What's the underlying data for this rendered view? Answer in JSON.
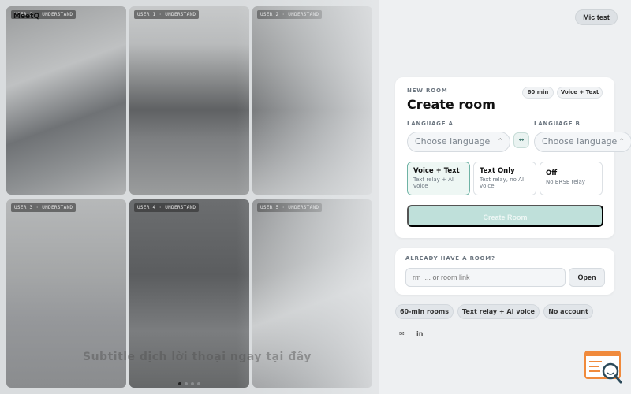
{
  "app": {
    "brand": "MeetQ"
  },
  "gallery": {
    "tiles": [
      {
        "tag": "USER_1 · UNDERSTAND"
      },
      {
        "tag": "USER_1 · UNDERSTAND"
      },
      {
        "tag": "USER_2 · UNDERSTAND"
      },
      {
        "tag": "USER_3 · UNDERSTAND"
      },
      {
        "tag": "USER_4 · UNDERSTAND"
      },
      {
        "tag": "USER_5 · UNDERSTAND"
      }
    ],
    "subtitle": "Subtitle dịch lời thoại ngay tại đây",
    "pager_active": 1
  },
  "header": {
    "mic_test": "Mic test"
  },
  "create_room": {
    "eyebrow": "NEW ROOM",
    "title": "Create room",
    "duration_pill": "60 min",
    "mode_pill": "Voice + Text",
    "language_a_label": "LANGUAGE A",
    "language_b_label": "LANGUAGE B",
    "language_a_value": "Choose language",
    "language_b_value": "Choose language",
    "swap_symbol": "↔",
    "modes": [
      {
        "title": "Voice + Text",
        "desc": "Text relay + AI voice",
        "selected": true
      },
      {
        "title": "Text Only",
        "desc": "Text relay, no AI voice",
        "selected": false
      },
      {
        "title": "Off",
        "desc": "No BRSE relay",
        "selected": false
      }
    ],
    "create_button": "Create Room"
  },
  "join_room": {
    "eyebrow": "ALREADY HAVE A ROOM?",
    "placeholder": "rm_... or room link",
    "open_button": "Open"
  },
  "features": [
    "60-min rooms",
    "Text relay + AI voice",
    "No account"
  ],
  "social": {
    "mail": "✉",
    "linkedin": "in"
  },
  "colors": {
    "accent": "#6fb3a5",
    "fab": "#f08a3c"
  }
}
